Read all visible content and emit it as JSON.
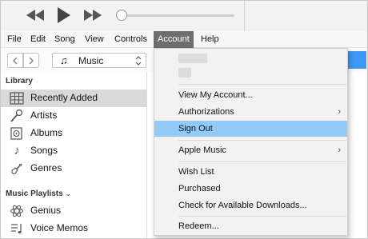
{
  "menu_bar": {
    "items": [
      "File",
      "Edit",
      "Song",
      "View",
      "Controls",
      "Account",
      "Help"
    ],
    "active": "Account"
  },
  "media_selector": {
    "label": "Music"
  },
  "sidebar": {
    "library_heading": "Library",
    "library_items": [
      {
        "label": "Recently Added",
        "icon": "grid-icon",
        "selected": true
      },
      {
        "label": "Artists",
        "icon": "microphone-icon"
      },
      {
        "label": "Albums",
        "icon": "album-icon"
      },
      {
        "label": "Songs",
        "icon": "music-note-icon"
      },
      {
        "label": "Genres",
        "icon": "guitar-icon"
      }
    ],
    "playlists_heading": "Music Playlists",
    "playlist_items": [
      {
        "label": "Genius",
        "icon": "genius-atom-icon"
      },
      {
        "label": "Voice Memos",
        "icon": "playlist-icon"
      }
    ]
  },
  "account_menu": {
    "items": [
      {
        "label": "View My Account..."
      },
      {
        "label": "Authorizations",
        "submenu": true
      },
      {
        "label": "Sign Out",
        "highlighted": true
      },
      {
        "label": "Apple Music",
        "submenu": true
      },
      {
        "label": "Wish List"
      },
      {
        "label": "Purchased"
      },
      {
        "label": "Check for Available Downloads..."
      },
      {
        "label": "Redeem..."
      }
    ]
  },
  "colors": {
    "menu_highlight": "#91c9f7",
    "active_menu": "#6e6e6e",
    "accent": "#3d98f5"
  }
}
